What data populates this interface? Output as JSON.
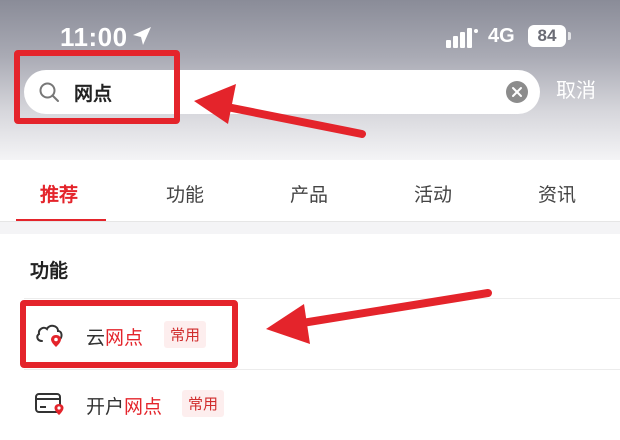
{
  "status_bar": {
    "time": "11:00",
    "network": "4G",
    "battery": "84"
  },
  "search": {
    "value": "网点",
    "cancel_label": "取消"
  },
  "tabs": [
    {
      "label": "推荐",
      "active": true
    },
    {
      "label": "功能",
      "active": false
    },
    {
      "label": "产品",
      "active": false
    },
    {
      "label": "活动",
      "active": false
    },
    {
      "label": "资讯",
      "active": false
    }
  ],
  "section": {
    "title": "功能"
  },
  "results": [
    {
      "prefix": "云",
      "highlight": "网点",
      "badge": "常用",
      "icon": "cloud-location-icon"
    },
    {
      "prefix": "开户",
      "highlight": "网点",
      "badge": "常用",
      "icon": "card-location-icon"
    }
  ],
  "colors": {
    "accent": "#e4242b",
    "annotation": "#e4242b"
  }
}
